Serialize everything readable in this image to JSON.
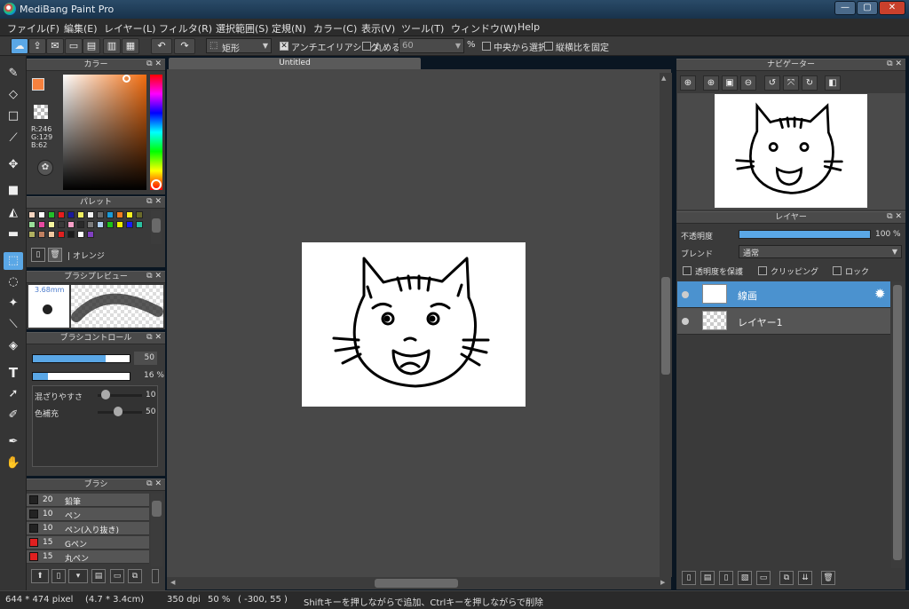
{
  "window": {
    "title": "MediBang Paint Pro",
    "min": "—",
    "max": "▢",
    "close": "✕"
  },
  "menu": [
    "ファイル(F)",
    "編集(E)",
    "レイヤー(L)",
    "フィルタ(R)",
    "選択範囲(S)",
    "定規(N)",
    "カラー(C)",
    "表示(V)",
    "ツール(T)",
    "ウィンドウ(W)",
    "Help"
  ],
  "toolbar": {
    "shape_select": "矩形",
    "antialias_label": "アンチエイリアシング",
    "round_label": "丸める",
    "round_value": "60",
    "round_unit": "%",
    "center_label": "中央から選択",
    "aspect_label": "縦横比を固定"
  },
  "color_panel": {
    "title": "カラー",
    "r": "R:246",
    "g": "G:129",
    "b": "B:62",
    "fg_color": "#f6813e"
  },
  "palette_panel": {
    "title": "パレット",
    "selected_name": "オレンジ",
    "swatches": [
      "#f5d5c0",
      "#ffffff",
      "#22c02a",
      "#e81c1c",
      "#1a1a9a",
      "#f0f060",
      "#f4f4f4",
      "#6a6a6a",
      "#1a9ad8",
      "#f07a20",
      "#f8f020",
      "#6a6a2a",
      "#9adf9a",
      "#e84aa0",
      "#f8f8a0",
      "#3a3a3a",
      "#f8a0c8",
      "#2a2a2a",
      "#7a7a7a",
      "#b0d0f0",
      "#1ac01a",
      "#f0f000",
      "#1a1aff",
      "#2ac0a0",
      "#b0b060",
      "#c08060",
      "#f0c8a0",
      "#e02020",
      "#1a1a1a",
      "#ffffff",
      "#8040c0"
    ]
  },
  "brush_preview": {
    "title": "ブラシプレビュー",
    "size": "3.68mm"
  },
  "brush_control": {
    "title": "ブラシコントロール",
    "size_value": "50",
    "size_fraction": 0.75,
    "opacity_value": "16",
    "opacity_unit": "%",
    "opacity_fraction": 0.16,
    "mix_label": "混ざりやすさ",
    "mix_value": "10",
    "fill_label": "色補充",
    "fill_value": "50"
  },
  "brush_panel": {
    "title": "ブラシ",
    "items": [
      {
        "size": "20",
        "name": "鉛筆",
        "color": "#222222"
      },
      {
        "size": "10",
        "name": "ペン",
        "color": "#222222"
      },
      {
        "size": "10",
        "name": "ペン(入り抜き)",
        "color": "#222222"
      },
      {
        "size": "15",
        "name": "Gペン",
        "color": "#e02020"
      },
      {
        "size": "15",
        "name": "丸ペン",
        "color": "#e02020"
      }
    ]
  },
  "canvas": {
    "tab_title": "Untitled"
  },
  "navigator": {
    "title": "ナビゲーター"
  },
  "layers": {
    "title": "レイヤー",
    "opacity_label": "不透明度",
    "opacity_value": "100 %",
    "opacity_fraction": 1.0,
    "blend_label": "ブレンド",
    "blend_value": "通常",
    "protect_label": "透明度を保護",
    "clip_label": "クリッピング",
    "lock_label": "ロック",
    "items": [
      {
        "name": "線画",
        "active": true
      },
      {
        "name": "レイヤー1",
        "active": false
      }
    ]
  },
  "status": {
    "size": "644 * 474 pixel",
    "physical": "(4.7 * 3.4cm)",
    "dpi": "350 dpi",
    "zoom": "50 %",
    "coords": "( -300, 55 )",
    "hint": "Shiftキーを押しながらで追加、Ctrlキーを押しながらで削除"
  },
  "colors": {
    "accent": "#5aa7e6",
    "layer_active": "#4b92cf"
  }
}
